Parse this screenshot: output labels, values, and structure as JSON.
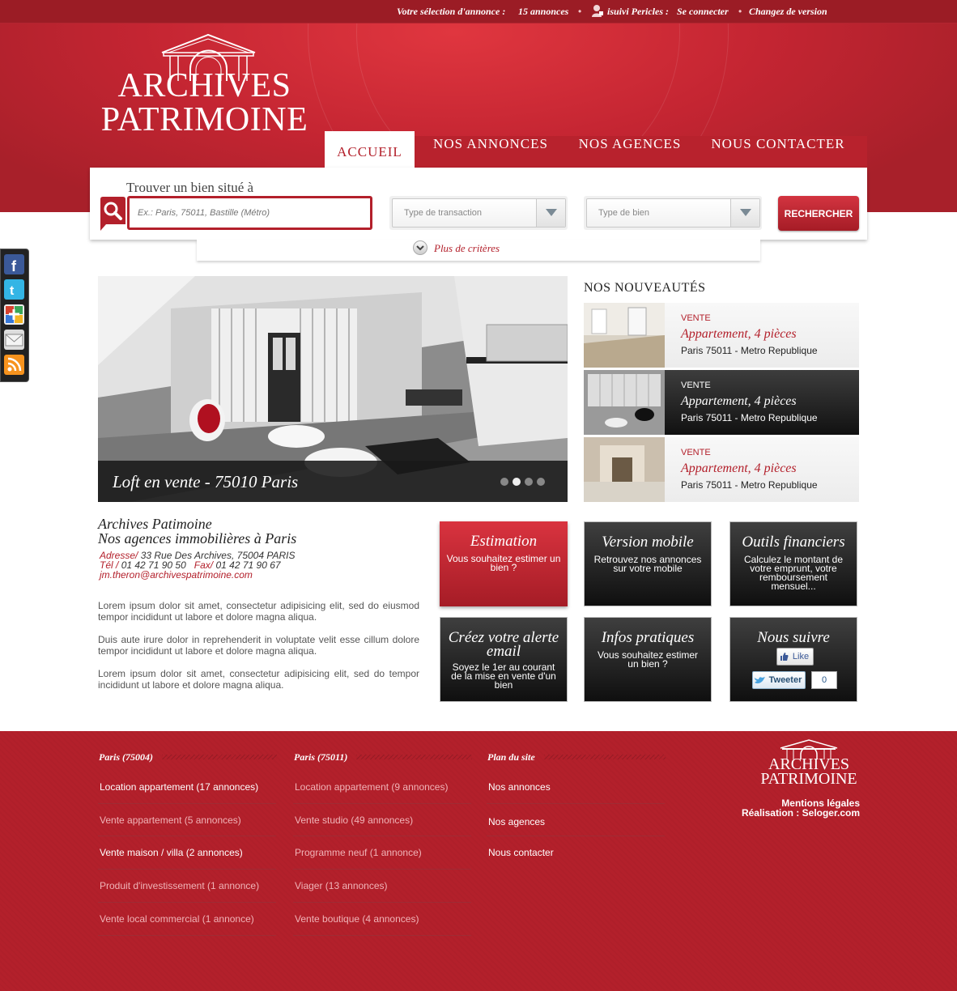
{
  "topbar": {
    "selection_label": "Votre sélection d'annonce :",
    "selection_count": "15 annonces",
    "user_label": "isuivi Pericles :",
    "connect_link": "Se connecter",
    "version_link": "Changez de version"
  },
  "logo": {
    "line1": "ARCHIVES",
    "line2": "PATRIMOINE"
  },
  "nav": {
    "items": [
      {
        "label": "ACCUEIL"
      },
      {
        "label": "NOS ANNONCES"
      },
      {
        "label": "NOS AGENCES"
      },
      {
        "label": "NOUS CONTACTER"
      }
    ]
  },
  "search": {
    "title": "Trouver un bien situé à",
    "placeholder": "Ex.: Paris, 75011, Bastille (Métro)",
    "transaction_placeholder": "Type de transaction",
    "bien_placeholder": "Type de bien",
    "button_label": "RECHERCHER",
    "more_criteria": "Plus de critères"
  },
  "social": {
    "icons": [
      "facebook-icon",
      "twitter-icon",
      "google-plus-icon",
      "email-icon",
      "rss-icon"
    ],
    "colors": {
      "facebook": "#3b5998",
      "twitter": "#33ccff",
      "rss": "#f7931e"
    }
  },
  "hero": {
    "caption": "Loft en vente - 75010 Paris",
    "slides": 4,
    "active_slide": 2
  },
  "news": {
    "heading": "NOS NOUVEAUTÉS",
    "items": [
      {
        "tag": "VENTE",
        "title": "Appartement, 4 pièces",
        "location": "Paris 75011 - Metro Republique"
      },
      {
        "tag": "VENTE",
        "title": "Appartement, 4 pièces",
        "location": "Paris 75011 - Metro Republique"
      },
      {
        "tag": "VENTE",
        "title": "Appartement, 4 pièces",
        "location": "Paris 75011 - Metro Republique"
      }
    ]
  },
  "agency": {
    "name": "Archives Patimoine",
    "subtitle": "Nos agences immobilières à Paris",
    "address_label": "Adresse/",
    "address": "33 Rue Des Archives, 75004 PARIS",
    "tel_label": "Tél /",
    "tel": "01 42 71 90 50",
    "fax_label": "Fax/",
    "fax": "01 42 71 90 67",
    "email": "jm.theron@archivespatrimoine.com",
    "paragraphs": [
      "Lorem ipsum dolor sit amet, consectetur adipisicing elit, sed do eiusmod tempor incididunt ut labore et dolore magna aliqua.",
      "Duis aute irure dolor in reprehenderit in voluptate velit esse cillum dolore tempor incididunt ut labore et dolore magna aliqua.",
      "Lorem ipsum dolor sit amet, consectetur adipisicing elit, sed do tempor incididunt ut labore et dolore magna aliqua."
    ]
  },
  "tiles": {
    "estimation": {
      "title": "Estimation",
      "desc": "Vous souhaitez estimer un bien ?"
    },
    "mobile": {
      "title": "Version mobile",
      "desc": "Retrouvez nos annonces sur votre mobile"
    },
    "financiers": {
      "title": "Outils financiers",
      "desc": "Calculez le montant de votre emprunt, votre remboursement mensuel..."
    },
    "alerte": {
      "title": "Créez votre alerte email",
      "desc": "Soyez le 1er au courant de la mise en vente d'un bien"
    },
    "infos": {
      "title": "Infos pratiques",
      "desc": "Vous souhaitez estimer un bien ?"
    },
    "suivre": {
      "title": "Nous suivre",
      "like": "Like",
      "tweet": "Tweeter",
      "tweet_count": "0"
    }
  },
  "footer": {
    "col1": {
      "title": "Paris (75004)",
      "links": [
        "Location appartement (17 annonces)",
        "Vente appartement (5 annonces)",
        "Vente maison / villa (2 annonces)",
        "Produit d'investissement (1 annonce)",
        "Vente local commercial (1 annonce)"
      ]
    },
    "col2": {
      "title": "Paris (75011)",
      "links": [
        "Location appartement (9 annonces)",
        "Vente studio (49 annonces)",
        "Programme neuf (1 annonce)",
        "Viager (13 annonces)",
        "Vente boutique (4 annonces)"
      ]
    },
    "col3": {
      "title": "Plan du site",
      "links": [
        "Nos annonces",
        "Nos agences",
        "Nous contacter"
      ]
    },
    "logo_line1": "ARCHIVES",
    "logo_line2": "PATRIMOINE",
    "mentions": "Mentions légales",
    "realisation": "Réalisation : Seloger.com"
  },
  "colors": {
    "brand_red": "#b3202b",
    "dark_tile": "#1a1a1a"
  }
}
